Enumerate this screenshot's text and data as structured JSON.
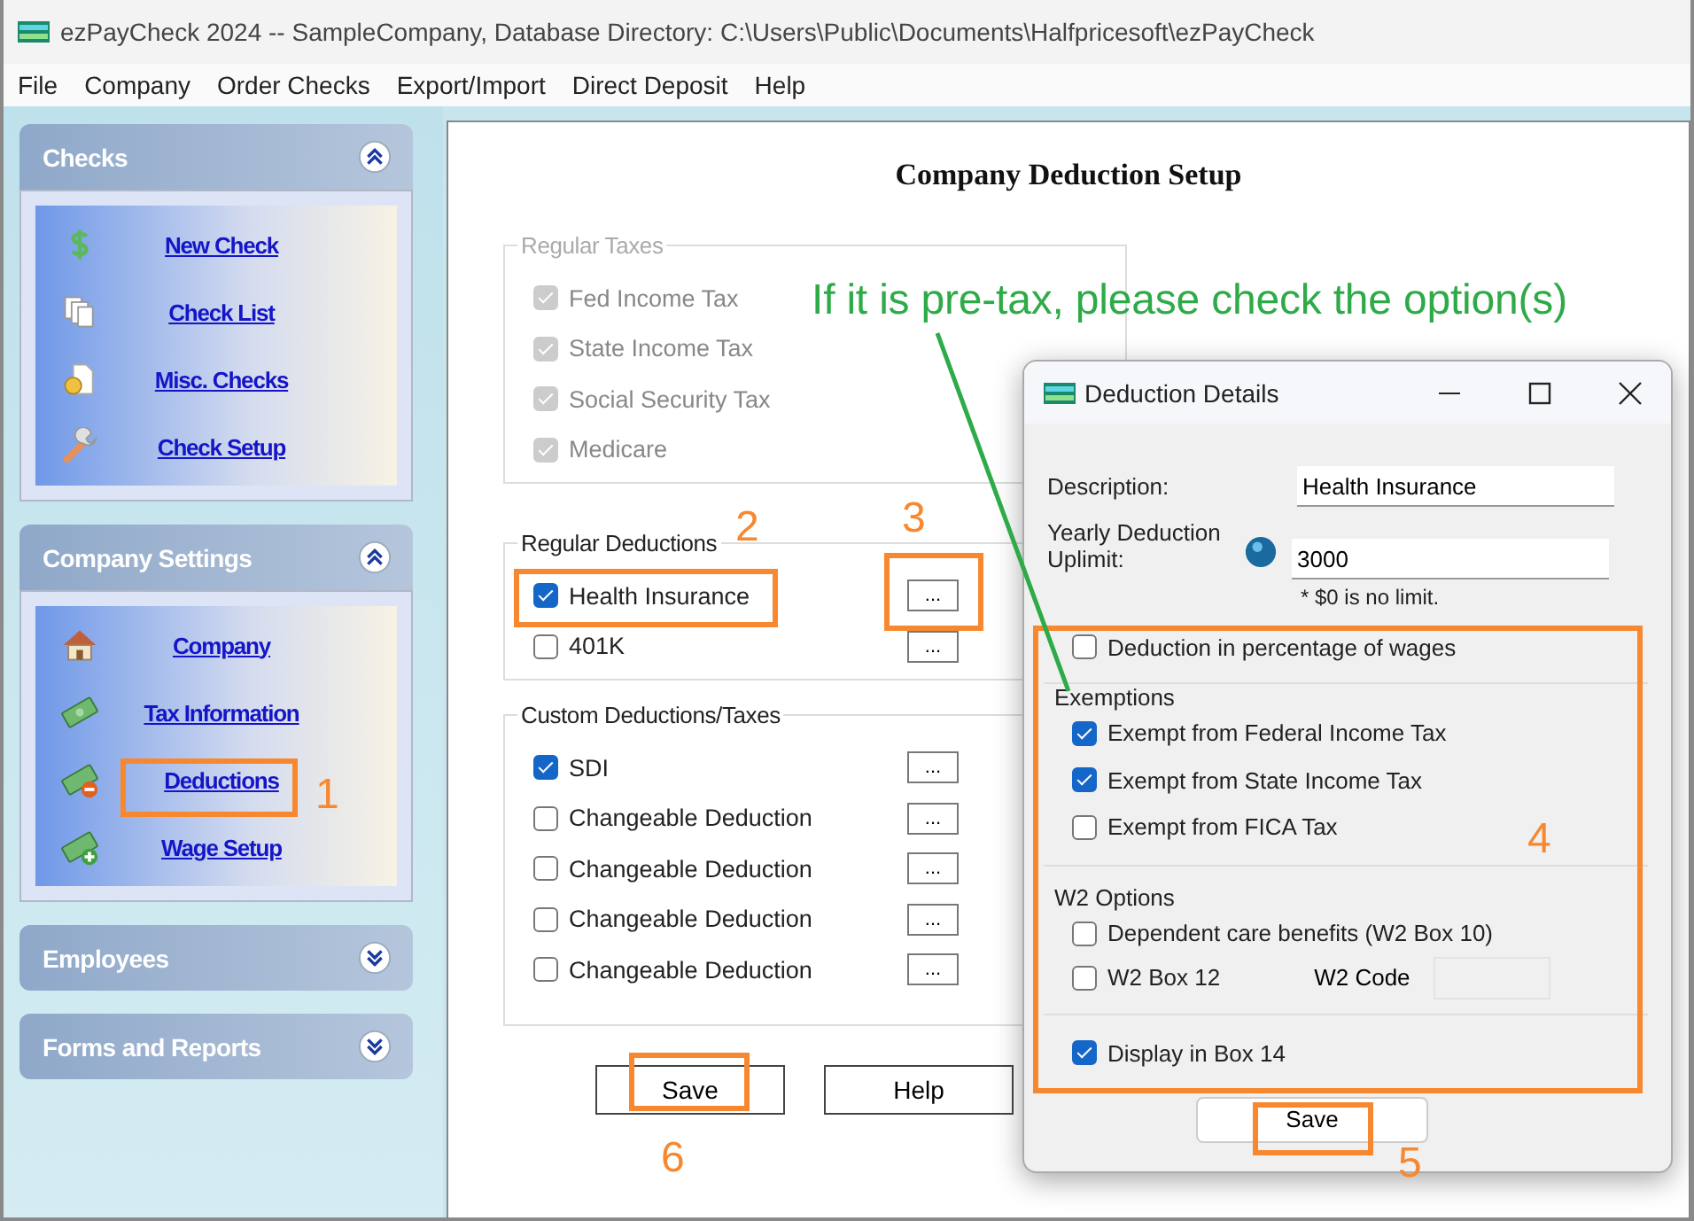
{
  "window": {
    "title": "ezPayCheck 2024 -- SampleCompany, Database Directory: C:\\Users\\Public\\Documents\\Halfpricesoft\\ezPayCheck"
  },
  "menu": [
    "File",
    "Company",
    "Order Checks",
    "Export/Import",
    "Direct Deposit",
    "Help"
  ],
  "sidebar": {
    "groups": [
      {
        "title": "Checks",
        "expanded": true,
        "items": [
          {
            "label": "New Check",
            "kind": "dollar"
          },
          {
            "label": "Check List",
            "kind": "pages"
          },
          {
            "label": "Misc. Checks",
            "kind": "document"
          },
          {
            "label": "Check Setup",
            "kind": "wrench"
          }
        ]
      },
      {
        "title": "Company Settings",
        "expanded": true,
        "items": [
          {
            "label": "Company",
            "kind": "house"
          },
          {
            "label": "Tax Information",
            "kind": "money"
          },
          {
            "label": "Deductions",
            "kind": "minus"
          },
          {
            "label": "Wage Setup",
            "kind": "plus"
          }
        ]
      },
      {
        "title": "Employees",
        "expanded": false
      },
      {
        "title": "Forms and Reports",
        "expanded": false
      }
    ]
  },
  "setup": {
    "title": "Company Deduction Setup",
    "regular_taxes": {
      "title": "Regular Taxes",
      "items": [
        {
          "label": "Fed Income Tax",
          "checked": true,
          "disabled": true
        },
        {
          "label": "State Income Tax",
          "checked": true,
          "disabled": true
        },
        {
          "label": "Social Security Tax",
          "checked": true,
          "disabled": true
        },
        {
          "label": "Medicare",
          "checked": true,
          "disabled": true
        }
      ]
    },
    "regular_deductions": {
      "title": "Regular Deductions",
      "items": [
        {
          "label": "Health Insurance",
          "checked": true,
          "details_button": "..."
        },
        {
          "label": "401K",
          "checked": false,
          "details_button": "..."
        }
      ]
    },
    "custom_deductions": {
      "title": "Custom Deductions/Taxes",
      "items": [
        {
          "label": "SDI",
          "checked": true,
          "details_button": "..."
        },
        {
          "label": "Changeable Deduction",
          "checked": false,
          "details_button": "..."
        },
        {
          "label": "Changeable Deduction",
          "checked": false,
          "details_button": "..."
        },
        {
          "label": "Changeable Deduction",
          "checked": false,
          "details_button": "..."
        },
        {
          "label": "Changeable Deduction",
          "checked": false,
          "details_button": "..."
        }
      ]
    },
    "buttons": [
      "Save",
      "Help"
    ]
  },
  "dialog": {
    "title": "Deduction Details",
    "description": {
      "label": "Description:",
      "value": "Health Insurance"
    },
    "limit": {
      "label": "Yearly Deduction Uplimit:",
      "value": "3000",
      "note": "* $0 is no limit."
    },
    "percentage": {
      "label": "Deduction in percentage of wages",
      "checked": false
    },
    "exemptions": {
      "title": "Exemptions",
      "items": [
        {
          "label": "Exempt from Federal Income Tax",
          "checked": true
        },
        {
          "label": "Exempt from State Income Tax",
          "checked": true
        },
        {
          "label": "Exempt from FICA Tax",
          "checked": false
        }
      ]
    },
    "w2_options": {
      "title": "W2 Options",
      "items": [
        {
          "label": "Dependent care benefits (W2 Box 10)",
          "checked": false
        },
        {
          "label": "W2 Box 12",
          "checked": false
        }
      ],
      "code_label": "W2 Code"
    },
    "box14": {
      "label": "Display in Box 14",
      "checked": true
    },
    "save": "Save"
  },
  "annotations": {
    "note": "If it is pre-tax, please check the option(s)",
    "markers": [
      "1",
      "2",
      "3",
      "4",
      "5",
      "6"
    ]
  }
}
